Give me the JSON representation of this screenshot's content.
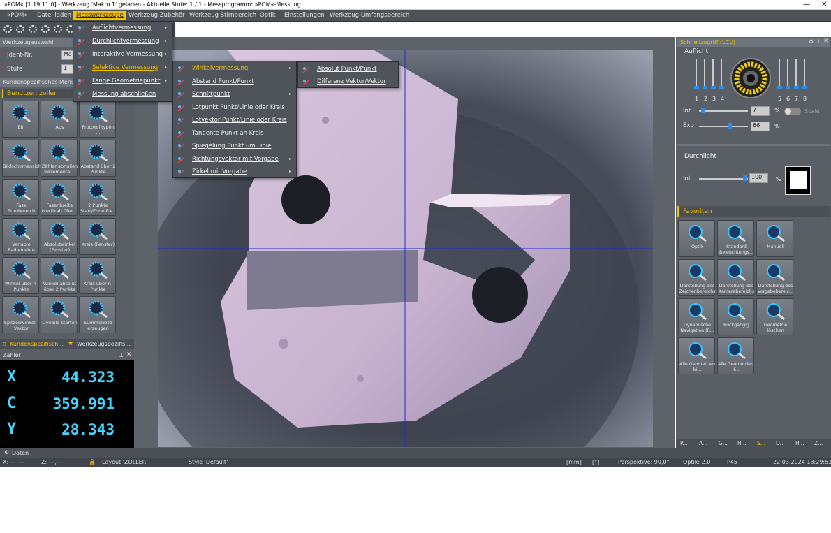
{
  "window": {
    "title": "»POM« [1.19.11.0] - Werkzeug 'Makro 1' geladen - Aktuelle Stufe: 1 / 1 - Messprogramm: »POM«-Messung",
    "min": "—",
    "close": "✕"
  },
  "menubar": [
    "»POM«",
    "Datei laden",
    "Messwerkzeuge",
    "Werkzeug Zubehör",
    "Werkzeug Stirnbereich",
    "Optik",
    "Einstellungen",
    "Werkzeug Umfangsbereich"
  ],
  "tool_selection": {
    "header": "Werkzeugauswahl",
    "ident_label": "Ident-Nr.",
    "ident_value": "Ma",
    "stufe_label": "Stufe",
    "stufe_value": "1"
  },
  "customer_menu": {
    "header": "Kundenspezifisches Menü",
    "user": "Benutzer: zoller"
  },
  "tiles": [
    {
      "label": "Ein",
      "icon": "light-on-icon"
    },
    {
      "label": "Aus",
      "icon": "light-off-icon"
    },
    {
      "label": "Protokolltypen ...",
      "icon": "printer-icon"
    },
    {
      "label": "Bildschirmansicht",
      "icon": "camera-icon"
    },
    {
      "label": "Zähler abnullen (Inkremental ...",
      "icon": "zero-counter-icon"
    },
    {
      "label": "Abstand über 2 Punkte",
      "icon": "distance-icon"
    },
    {
      "label": "Fase Stirnbereich",
      "icon": "chamfer-icon"
    },
    {
      "label": "Fasenbreite (vertikal) über...",
      "icon": "chamfer-width-icon"
    },
    {
      "label": "2 Punkte Start/Ende-Ra...",
      "icon": "two-points-icon"
    },
    {
      "label": "Variable Radienlehre",
      "icon": "radius-gauge-icon"
    },
    {
      "label": "Absolutwinkel (Fenster)",
      "icon": "absolute-angle-icon"
    },
    {
      "label": "Kreis (Fenster)",
      "icon": "circle-window-icon"
    },
    {
      "label": "Winkel über n-Punkte",
      "icon": "angle-n-points-icon"
    },
    {
      "label": "Winkel absolut über 2 Punkte",
      "icon": "angle-absolute-icon"
    },
    {
      "label": "Kreis über n-Punkte",
      "icon": "circle-n-points-icon"
    },
    {
      "label": "Spitzenwinkel - Vektor",
      "icon": "point-angle-icon"
    },
    {
      "label": "Livebild starten",
      "icon": "live-image-icon"
    },
    {
      "label": "Summenbild erzeugen",
      "icon": "sum-image-icon"
    }
  ],
  "left_tabs": [
    "Kundenspezifisch...",
    "Werkzeugspezifis..."
  ],
  "counter": {
    "header": "Zähler",
    "rows": [
      {
        "axis": "X",
        "value": "44.323"
      },
      {
        "axis": "C",
        "value": "359.991"
      },
      {
        "axis": "Y",
        "value": "28.343"
      }
    ]
  },
  "menu_measure": [
    {
      "label": "Auflichtvermessung"
    },
    {
      "label": "Durchlichtvermessung"
    },
    {
      "label": "Interaktive Vermessung"
    },
    {
      "label": "Selektive Vermessung"
    },
    {
      "label": "Fange Geometriepunkt"
    },
    {
      "label": "Messung abschließen"
    }
  ],
  "menu_selective": [
    {
      "label": "Winkelvermessung"
    },
    {
      "label": "Abstand Punkt/Punkt"
    },
    {
      "label": "Schnittpunkt"
    },
    {
      "label": "Lotpunkt Punkt/Linie oder Kreis"
    },
    {
      "label": "Lotvektor Punkt/Linie oder Kreis"
    },
    {
      "label": "Tangente Punkt an Kreis"
    },
    {
      "label": "Spiegelung Punkt um Linie"
    },
    {
      "label": "Richtungsvektor mit Vorgabe"
    },
    {
      "label": "Zirkel mit Vorgabe"
    }
  ],
  "menu_angle": [
    {
      "label": "Absolut Punkt/Punkt"
    },
    {
      "label": "Differenz Vektor/Vektor"
    }
  ],
  "quick_access": {
    "header": "Schnellzugriff (LCU)",
    "auflicht": "Auflicht",
    "segments": [
      "1",
      "2",
      "3",
      "4",
      "5",
      "6",
      "7",
      "8"
    ],
    "int_label": "Int",
    "int_value": "7",
    "exp_label": "Exp",
    "exp_value": "66",
    "pct": "%",
    "scale": "Scale",
    "durchlicht": "Durchlicht",
    "dint_label": "Int",
    "dint_value": "100"
  },
  "favorites": {
    "header": "Favoriten",
    "items": [
      {
        "label": "Optik",
        "icon": "zoom-icon"
      },
      {
        "label": "Standard Beleuchtungs...",
        "icon": "standard-light-icon"
      },
      {
        "label": "Manuell",
        "icon": "manual-light-icon"
      },
      {
        "label": "Darstellung des Zeichenbereichs",
        "icon": "drawing-area-icon"
      },
      {
        "label": "Darstellung des Kamerabereichs",
        "icon": "camera-area-icon"
      },
      {
        "label": "Darstellung des Vorgabebereic...",
        "icon": "preset-area-icon"
      },
      {
        "label": "Dynamische Navigation (R...",
        "icon": "navigation-icon"
      },
      {
        "label": "Rückgängig",
        "icon": "undo-icon"
      },
      {
        "label": "Geometrie löschen",
        "icon": "delete-geometry-icon"
      },
      {
        "label": "Alle Geometrien ki...",
        "icon": "delete-all-icon"
      },
      {
        "label": "Alle Geometrien, F...",
        "icon": "delete-all-f-icon"
      }
    ]
  },
  "right_tabs": [
    "P...",
    "A...",
    "G...",
    "H...",
    "S...",
    "D...",
    "H...",
    "Z..."
  ],
  "bottom_tab": "Daten",
  "status": {
    "x": "X: ---,---",
    "z": "Z: ---,---",
    "layout": "Layout 'ZOLLER'",
    "style": "Style 'Default'",
    "unit": "[mm]",
    "deg": "[°]",
    "perspective": "Perspektive: 90,0°",
    "optik": "Optik: 2.0",
    "p45": "P45",
    "datetime": "22.03.2024 13:29:53"
  },
  "colors": {
    "accent": "#f2c200",
    "counter": "#45d6ff",
    "crosshair": "#1f2cd6"
  }
}
